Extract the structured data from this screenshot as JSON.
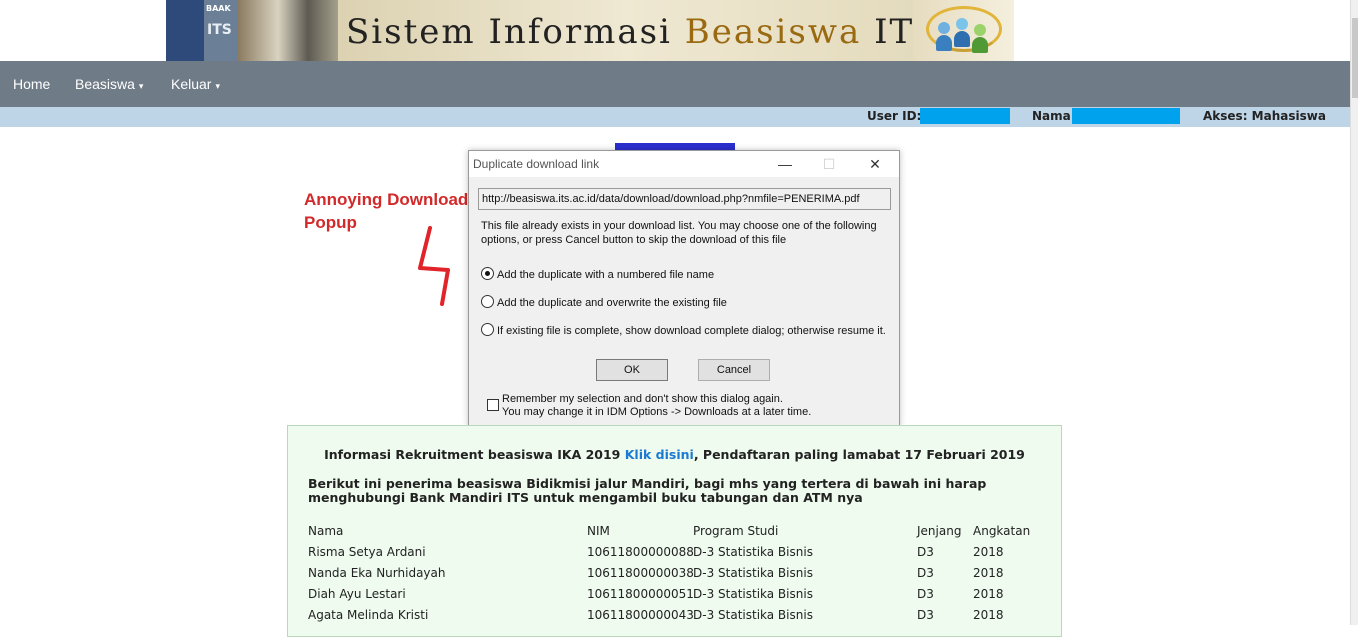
{
  "header": {
    "logo_baak": "BAAK",
    "logo_its": "ITS",
    "title_parts": [
      "Sistem Informasi ",
      "Beasiswa",
      " ITS"
    ]
  },
  "navbar": {
    "items": [
      {
        "label": "Home",
        "has_caret": false
      },
      {
        "label": "Beasiswa",
        "has_caret": true
      },
      {
        "label": "Keluar",
        "has_caret": true
      }
    ],
    "caret": "▾"
  },
  "userbar": {
    "user_id_label": "User ID:",
    "nama_label": "Nama:",
    "akses": "Akses: Mahasiswa",
    "redaction_color": "#00a2ed"
  },
  "annotation": {
    "line1": "Annoying Download",
    "line2": "Popup",
    "color": "#d22a2a"
  },
  "dialog": {
    "title": "Duplicate download link",
    "minimize": "—",
    "maximize": "☐",
    "close": "✕",
    "url": "http://beasiswa.its.ac.id/data/download/download.php?nmfile=PENERIMA.pdf",
    "message_line1": "This file already exists in your download list. You may choose one of the following",
    "message_line2": "options, or press Cancel button to skip the download of this file",
    "options": [
      {
        "label": "Add the duplicate with a numbered file name",
        "checked": true
      },
      {
        "label": "Add the duplicate and overwrite the existing file",
        "checked": false
      },
      {
        "label": "If existing file is complete, show download complete dialog; otherwise resume it.",
        "checked": false
      }
    ],
    "ok_label": "OK",
    "cancel_label": "Cancel",
    "remember_line1": "Remember my selection and don't show this dialog again.",
    "remember_line2": "You may change it in IDM Options -> Downloads at a later time.",
    "remember_checked": false
  },
  "panel": {
    "info1_before": "Informasi Rekruitment beasiswa IKA 2019 ",
    "info1_link": "Klik disini",
    "info1_after": ", Pendaftaran paling lamabat 17 Februari 2019",
    "info2": "Berikut ini penerima beasiswa Bidikmisi jalur Mandiri, bagi mhs yang tertera di bawah ini harap menghubungi Bank Mandiri ITS untuk mengambil buku tabungan dan ATM nya",
    "columns": [
      "Nama",
      "NIM",
      "Program Studi",
      "Jenjang",
      "Angkatan"
    ],
    "rows": [
      [
        "Risma Setya Ardani",
        "10611800000088",
        "D-3 Statistika Bisnis",
        "D3",
        "2018"
      ],
      [
        "Nanda Eka Nurhidayah",
        "10611800000038",
        "D-3 Statistika Bisnis",
        "D3",
        "2018"
      ],
      [
        "Diah Ayu Lestari",
        "10611800000051",
        "D-3 Statistika Bisnis",
        "D3",
        "2018"
      ],
      [
        "Agata Melinda Kristi",
        "10611800000043",
        "D-3 Statistika Bisnis",
        "D3",
        "2018"
      ]
    ]
  }
}
